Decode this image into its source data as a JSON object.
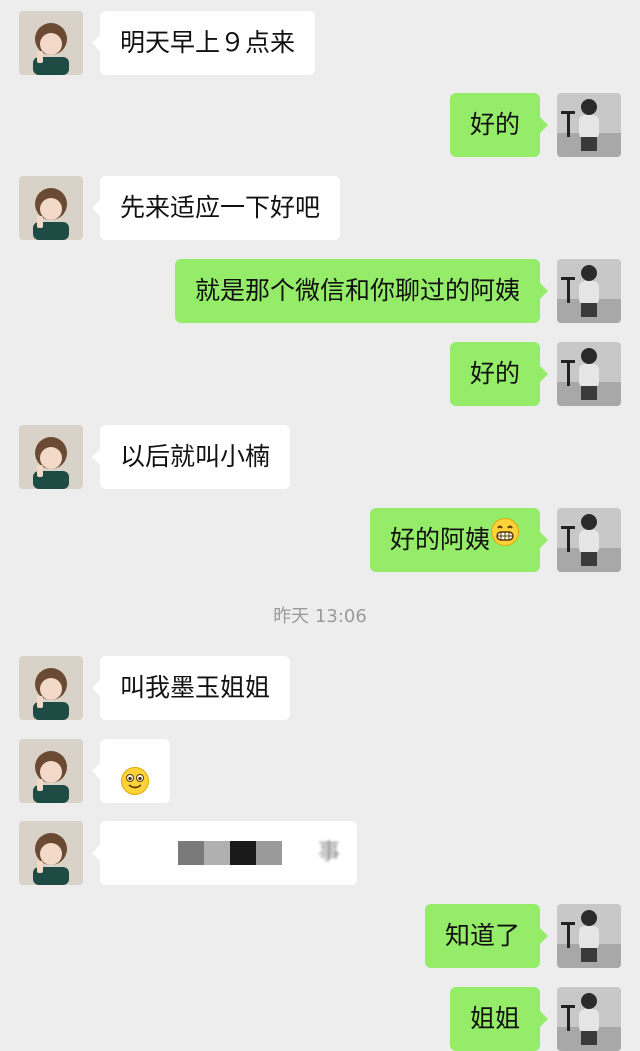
{
  "colors": {
    "background": "#ededed",
    "incoming_bubble": "#ffffff",
    "outgoing_bubble": "#95ec69"
  },
  "icons": {
    "contact_avatar": "contact-avatar-icon",
    "my_avatar": "my-avatar-icon",
    "grin": "grinning-face-icon",
    "smile": "smiling-face-icon"
  },
  "messages": [
    {
      "side": "left",
      "text": "明天早上９点来"
    },
    {
      "side": "right",
      "text": "好的"
    },
    {
      "side": "left",
      "text": "先来适应一下好吧"
    },
    {
      "side": "right",
      "text": "就是那个微信和你聊过的阿姨"
    },
    {
      "side": "right",
      "text": "好的"
    },
    {
      "side": "left",
      "text": "以后就叫小楠"
    },
    {
      "side": "right",
      "text": "好的阿姨"
    },
    {
      "side": "left",
      "text": "叫我墨玉姐姐"
    },
    {
      "side": "left",
      "text": ""
    },
    {
      "side": "left",
      "text": ""
    },
    {
      "side": "right",
      "text": "知道了"
    },
    {
      "side": "right",
      "text": "姐姐"
    }
  ],
  "timestamp": "昨天 13:06",
  "redacted_tail": "事"
}
